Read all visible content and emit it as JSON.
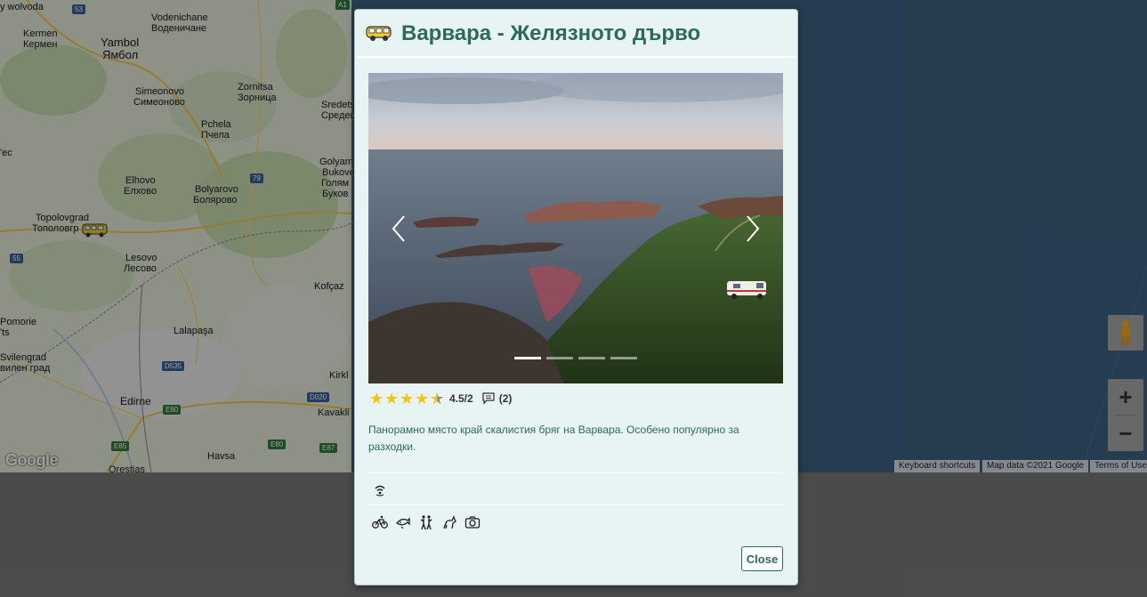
{
  "map": {
    "labels": [
      {
        "text": "Kermen",
        "id": "kermen"
      },
      {
        "text": "Кермен",
        "id": "kermen-cyr"
      },
      {
        "text": "Yambol",
        "id": "yambol"
      },
      {
        "text": "Ямбол",
        "id": "yambol-cyr"
      },
      {
        "text": "Vodenichane",
        "id": "vodenichane"
      },
      {
        "text": "Воденичане",
        "id": "vodenichane-cyr"
      },
      {
        "text": "Simeonovo",
        "id": "simeonovo"
      },
      {
        "text": "Симеоново",
        "id": "simeonovo-cyr"
      },
      {
        "text": "Zornitsa",
        "id": "zornitsa"
      },
      {
        "text": "Зорница",
        "id": "zornitsa-cyr"
      },
      {
        "text": "Pchela",
        "id": "pchela"
      },
      {
        "text": "Пчела",
        "id": "pchela-cyr"
      },
      {
        "text": "Elhovo",
        "id": "elhovo"
      },
      {
        "text": "Елхово",
        "id": "elhovo-cyr"
      },
      {
        "text": "Bolyarovo",
        "id": "bolyarovo"
      },
      {
        "text": "Болярово",
        "id": "bolyarovo-cyr"
      },
      {
        "text": "Topolovgrad",
        "id": "topolovgrad"
      },
      {
        "text": "Тополовгр",
        "id": "topolovgrad-cyr"
      },
      {
        "text": "Lesovo",
        "id": "lesovo"
      },
      {
        "text": "Лесово",
        "id": "lesovo-cyr"
      },
      {
        "text": "Kofçaz",
        "id": "kofcaz"
      },
      {
        "text": "Lalapaşa",
        "id": "lalapasa"
      },
      {
        "text": "Svilengrad",
        "id": "svilengrad"
      },
      {
        "text": "вилен град",
        "id": "svilengrad-cyr"
      },
      {
        "text": "Edirne",
        "id": "edirne"
      },
      {
        "text": "Havsa",
        "id": "havsa"
      },
      {
        "text": "Kirkl",
        "id": "kirkl"
      },
      {
        "text": "Kavakli",
        "id": "kavakli"
      },
      {
        "text": "Sredets",
        "id": "sredets"
      },
      {
        "text": "Средец",
        "id": "sredets-cyr"
      },
      {
        "text": "Golyam",
        "id": "golyam"
      },
      {
        "text": "Bukove",
        "id": "bukove"
      },
      {
        "text": "Голям",
        "id": "golyam-cyr"
      },
      {
        "text": "Буков",
        "id": "bukov-cyr"
      },
      {
        "text": "Orestias",
        "id": "orestias"
      },
      {
        "text": "Pomorie",
        "id": "pomorie"
      },
      {
        "text": "'ts",
        "id": "ts"
      },
      {
        "text": "'ec",
        "id": "ec"
      },
      {
        "text": "o",
        "id": "o"
      },
      {
        "text": "y wolvoda",
        "id": "wolvoda"
      }
    ],
    "road_badges": [
      "53",
      "A1",
      "79",
      "55",
      "D535",
      "D020",
      "E80",
      "E80",
      "E85",
      "E87"
    ],
    "google_logo": "Google",
    "footer": {
      "shortcuts": "Keyboard shortcuts",
      "map_data": "Map data ©2021 Google",
      "terms": "Terms of Use"
    }
  },
  "modal": {
    "title": "Варвара - Желязното дърво",
    "title_icon": "camper-van-icon",
    "carousel": {
      "slide_count": 4,
      "active_index": 0
    },
    "rating": {
      "value": 4.5,
      "max": 5,
      "display": "4.5/2",
      "comments": "(2)"
    },
    "description": "Панорамно място край скалистия бряг на Варвара. Особено популярно за разходки.",
    "amenities": [
      "wifi-icon"
    ],
    "activities": [
      "cycling-icon",
      "fishing-icon",
      "hiking-icon",
      "pets-icon",
      "camera-icon"
    ],
    "close_label": "Close"
  },
  "colors": {
    "accent": "#2c6b5a",
    "modal_bg": "#e8f3f3",
    "star": "#f2c511"
  }
}
